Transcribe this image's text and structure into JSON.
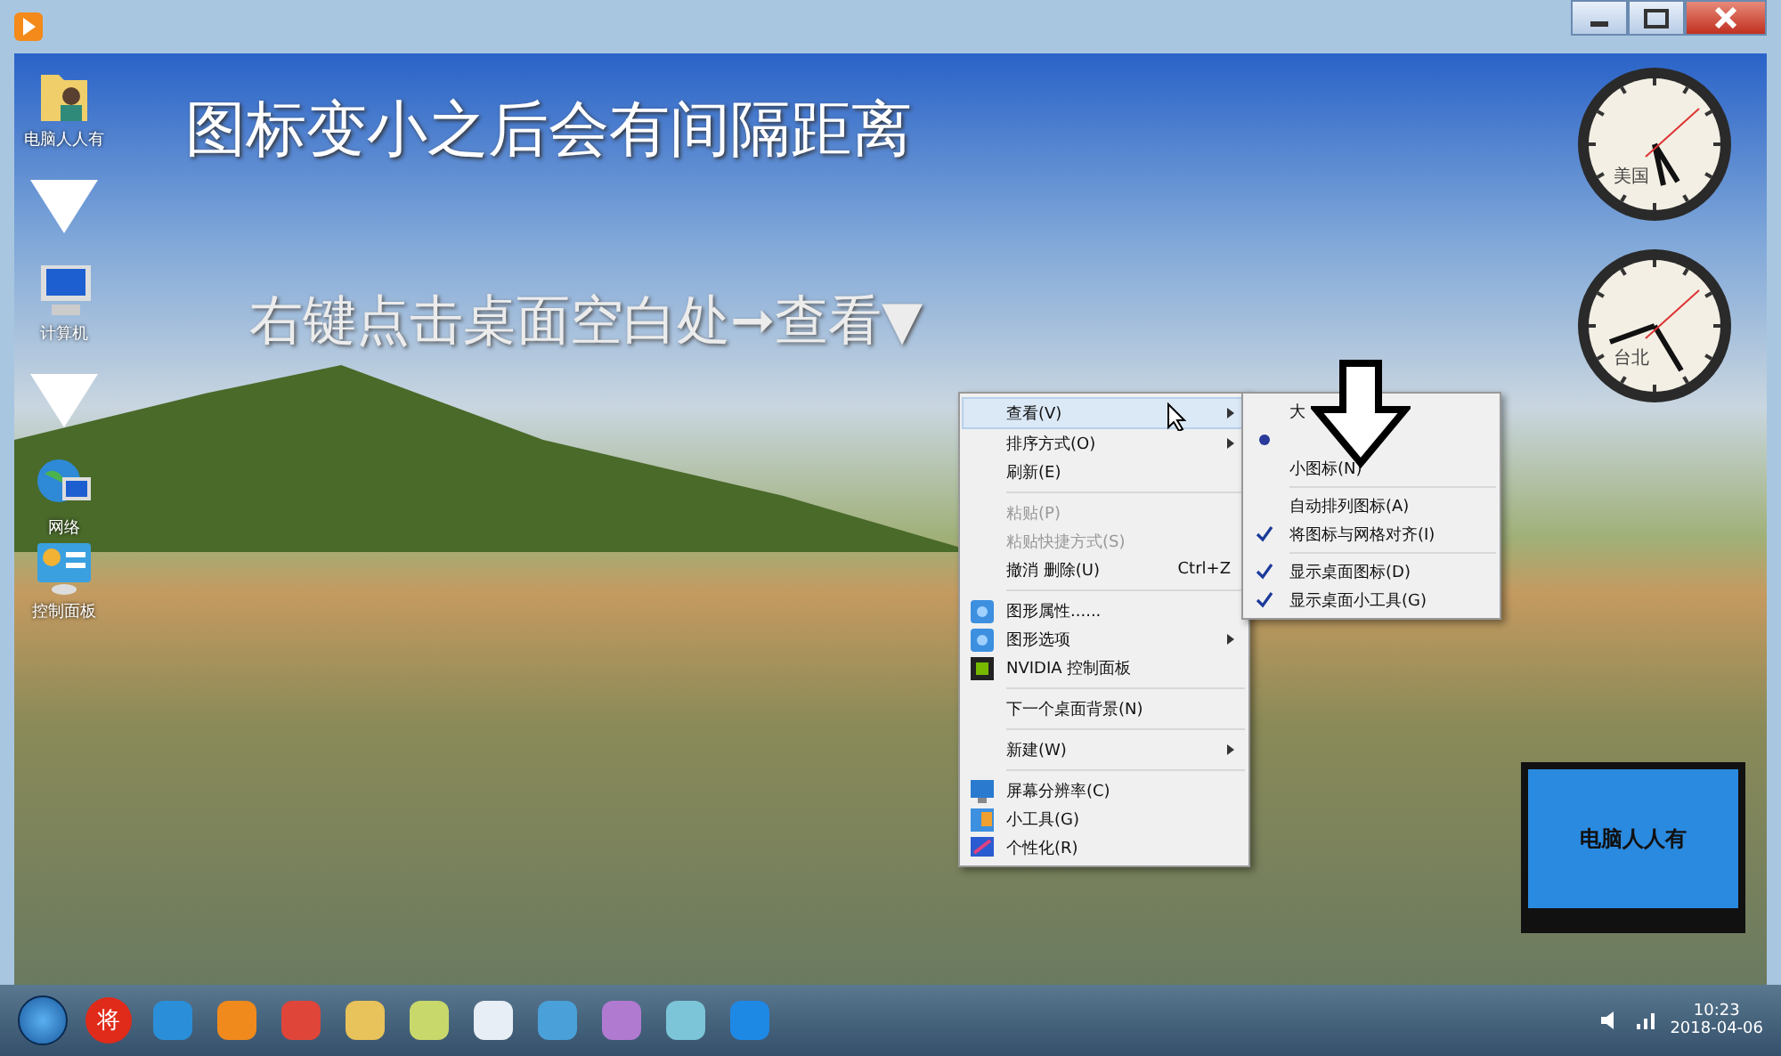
{
  "desktop": {
    "icons": [
      {
        "label": "电脑人人有",
        "kind": "folder"
      },
      {
        "label": "计算机",
        "kind": "computer"
      },
      {
        "label": "网络",
        "kind": "network"
      },
      {
        "label": "控制面板",
        "kind": "panel"
      }
    ],
    "captions": [
      "图标变小之后会有间隔距离",
      "右键点击桌面空白处➞查看▼"
    ],
    "clocks": [
      {
        "label": "美国"
      },
      {
        "label": "台北"
      }
    ],
    "logo": "电脑人人有"
  },
  "context_menu": {
    "items": [
      {
        "label": "查看(V)",
        "kind": "submenu",
        "disabled": false,
        "selected": true
      },
      {
        "label": "排序方式(O)",
        "kind": "submenu",
        "disabled": false,
        "selected": false
      },
      {
        "label": "刷新(E)",
        "kind": "plain",
        "disabled": false,
        "selected": false
      },
      {
        "kind": "separator"
      },
      {
        "label": "粘贴(P)",
        "kind": "plain",
        "disabled": true,
        "selected": false
      },
      {
        "label": "粘贴快捷方式(S)",
        "kind": "plain",
        "disabled": true,
        "selected": false
      },
      {
        "label": "撤消 删除(U)",
        "kind": "plain",
        "disabled": false,
        "selected": false,
        "shortcut": "Ctrl+Z"
      },
      {
        "kind": "separator"
      },
      {
        "label": "图形属性......",
        "kind": "plain",
        "disabled": false,
        "selected": false
      },
      {
        "label": "图形选项",
        "kind": "submenu",
        "disabled": false,
        "selected": false
      },
      {
        "label": "NVIDIA 控制面板",
        "kind": "plain",
        "disabled": false,
        "selected": false
      },
      {
        "kind": "separator"
      },
      {
        "label": "下一个桌面背景(N)",
        "kind": "plain",
        "disabled": false,
        "selected": false
      },
      {
        "kind": "separator"
      },
      {
        "label": "新建(W)",
        "kind": "submenu",
        "disabled": false,
        "selected": false
      },
      {
        "kind": "separator"
      },
      {
        "label": "屏幕分辨率(C)",
        "kind": "plain",
        "disabled": false,
        "selected": false
      },
      {
        "label": "小工具(G)",
        "kind": "plain",
        "disabled": false,
        "selected": false
      },
      {
        "label": "个性化(R)",
        "kind": "plain",
        "disabled": false,
        "selected": false
      }
    ]
  },
  "view_submenu": {
    "items": [
      {
        "label": "大",
        "kind": "radio",
        "checked": false
      },
      {
        "kind": "radio",
        "checked": true
      },
      {
        "label": "小图标(N)",
        "kind": "radio",
        "checked": false
      },
      {
        "kind": "separator"
      },
      {
        "label": "自动排列图标(A)",
        "kind": "check",
        "checked": false
      },
      {
        "label": "将图标与网格对齐(I)",
        "kind": "check",
        "checked": true
      },
      {
        "kind": "separator"
      },
      {
        "label": "显示桌面图标(D)",
        "kind": "check",
        "checked": true
      },
      {
        "label": "显示桌面小工具(G)",
        "kind": "check",
        "checked": true
      }
    ]
  },
  "taskbar": {
    "badge_app": "将",
    "time": "10:23",
    "date": "2018-04-06"
  }
}
